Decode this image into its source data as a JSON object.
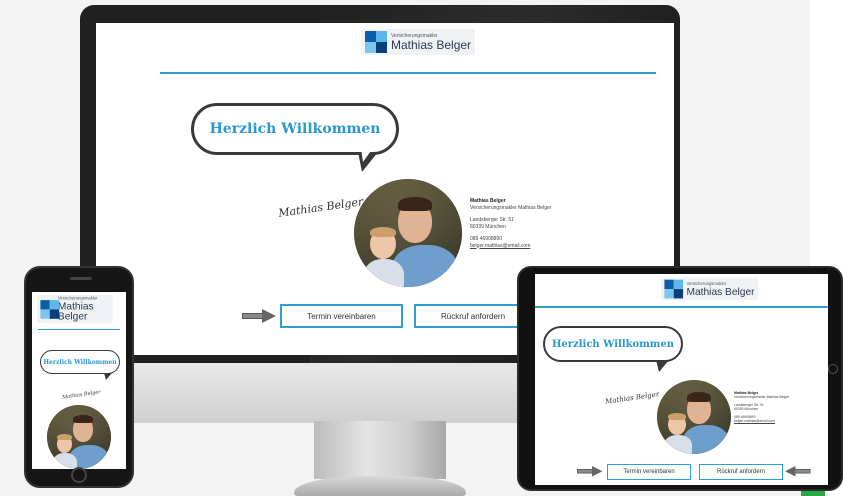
{
  "brand": {
    "tagline": "Versicherungsmakler",
    "name": "Mathias Belger"
  },
  "hero": {
    "greeting": "Herzlich Willkommen",
    "signature": "Mathias Belger"
  },
  "contact": {
    "name": "Mathias Belger",
    "company": "Versicherungsmakler Mathias Belger",
    "street": "Landsberger Str. 51",
    "city": "80339 München",
    "phone": "089 46908890",
    "email": "belger.mathias@email.com"
  },
  "actions": {
    "appointment": "Termin vereinbaren",
    "callback": "Rückruf anfordern"
  },
  "colors": {
    "accent": "#2ba0d2",
    "brand_dark": "#0b5cab",
    "bubble_outline": "#3a3a3a",
    "status_green": "#29a847"
  },
  "icons": {
    "logo": "logo-squares-icon",
    "arrow": "arrow-right-icon"
  }
}
